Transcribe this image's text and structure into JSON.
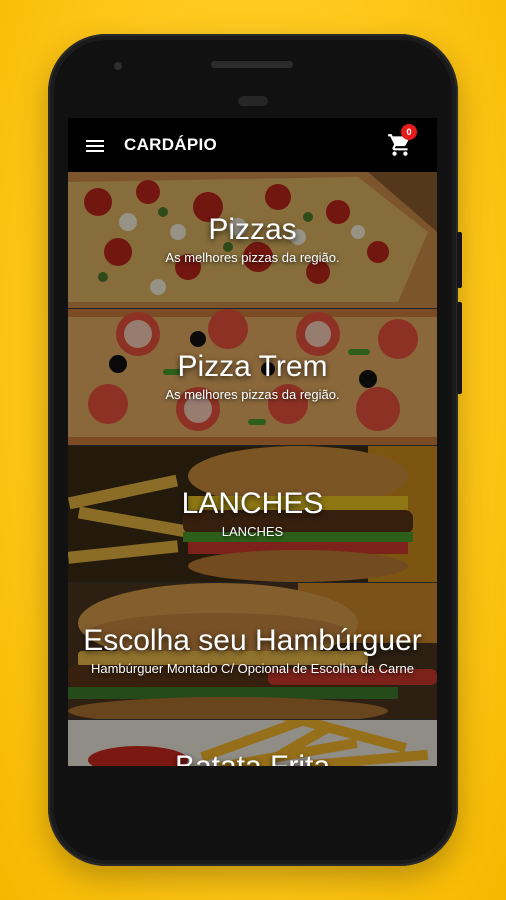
{
  "app": {
    "title": "CARDÁPIO",
    "cart_count": "0",
    "accent_color": "#e31b1b",
    "background_color": "#ffc81a"
  },
  "categories": [
    {
      "title": "Pizzas",
      "subtitle": "As melhores pizzas da região."
    },
    {
      "title": "Pizza Trem",
      "subtitle": "As melhores pizzas da região."
    },
    {
      "title": "LANCHES",
      "subtitle": "LANCHES"
    },
    {
      "title": "Escolha seu Hambúrguer",
      "subtitle": "Hambúrguer Montado C/ Opcional de Escolha da Carne"
    },
    {
      "title": "Batata Frita",
      "subtitle": ""
    }
  ],
  "icons": {
    "menu": "menu-icon",
    "cart": "cart-icon"
  }
}
